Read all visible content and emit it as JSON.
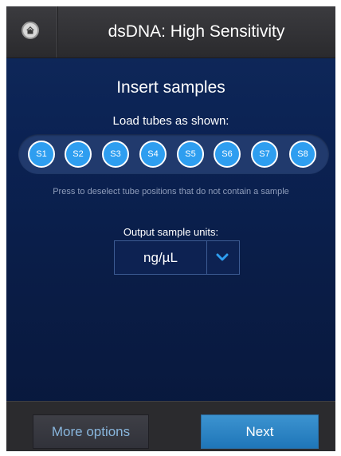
{
  "header": {
    "title": "dsDNA: High Sensitivity"
  },
  "main": {
    "heading": "Insert samples",
    "load_label": "Load tubes as shown:",
    "tubes": [
      "S1",
      "S2",
      "S3",
      "S4",
      "S5",
      "S6",
      "S7",
      "S8"
    ],
    "hint": "Press to deselect tube positions that do not contain a sample",
    "units_label": "Output sample units:",
    "units_value": "ng/µL"
  },
  "footer": {
    "more_label": "More options",
    "next_label": "Next"
  },
  "colors": {
    "tube": "#2e9ef0",
    "accent": "#2b86c8",
    "background": "#0b2253"
  },
  "icons": {
    "home": "home-icon",
    "dropdown": "chevron-down-icon"
  }
}
